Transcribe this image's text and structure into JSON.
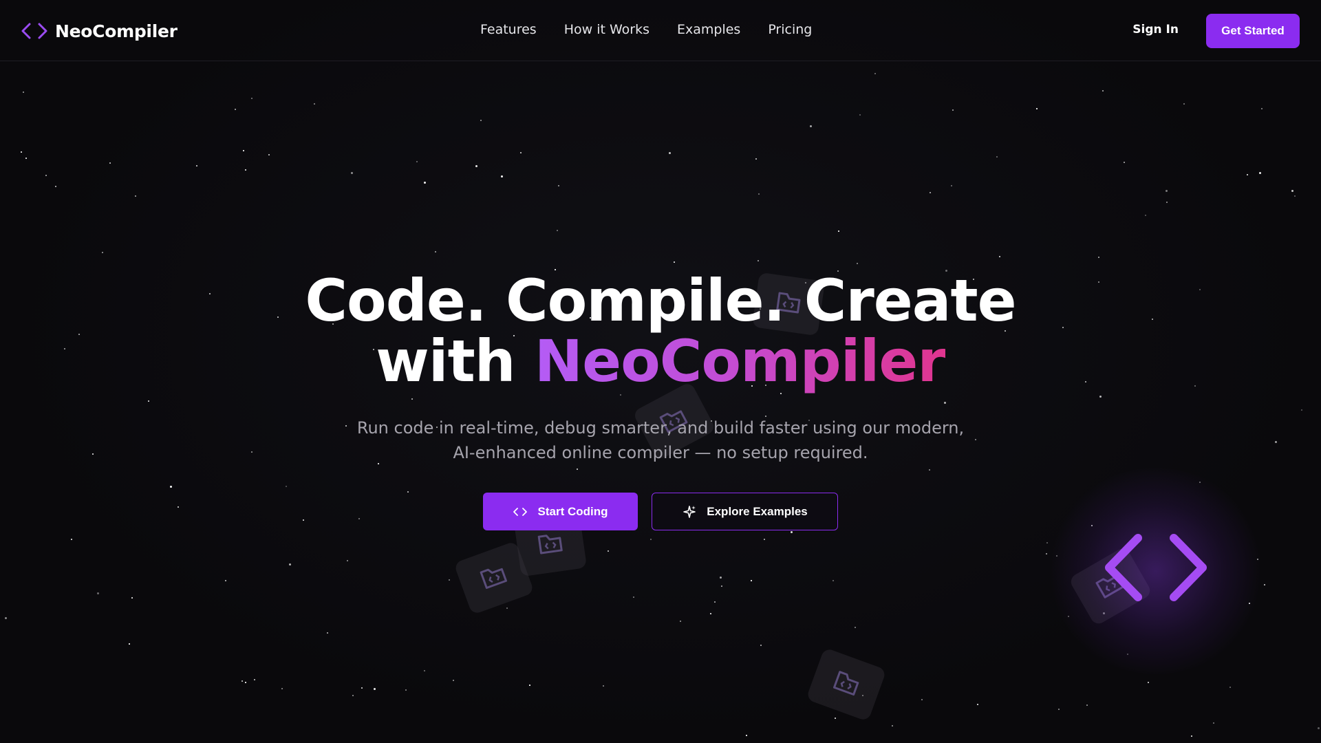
{
  "brand": {
    "name": "NeoCompiler",
    "icon": "code-brackets-icon",
    "accent_color": "#8b2cf0"
  },
  "nav": {
    "links": [
      {
        "label": "Features"
      },
      {
        "label": "How it Works"
      },
      {
        "label": "Examples"
      },
      {
        "label": "Pricing"
      }
    ],
    "sign_in": "Sign In",
    "get_started": "Get Started"
  },
  "hero": {
    "title_line1": "Code. Compile. Create",
    "title_line2_prefix": "with ",
    "title_line2_highlight": "NeoCompiler",
    "subtitle_line1": "Run code in real-time, debug smarter, and build faster using our modern,",
    "subtitle_line2": "AI-enhanced online compiler — no setup required.",
    "primary_button": {
      "label": "Start Coding",
      "icon": "code-brackets-icon"
    },
    "secondary_button": {
      "label": "Explore Examples",
      "icon": "sparkles-icon"
    },
    "gradient_colors": [
      "#b45cf5",
      "#c24dd6",
      "#e0358f"
    ]
  },
  "decorations": {
    "floating_icon": "code-folder-icon",
    "large_icon": "code-brackets-icon"
  }
}
